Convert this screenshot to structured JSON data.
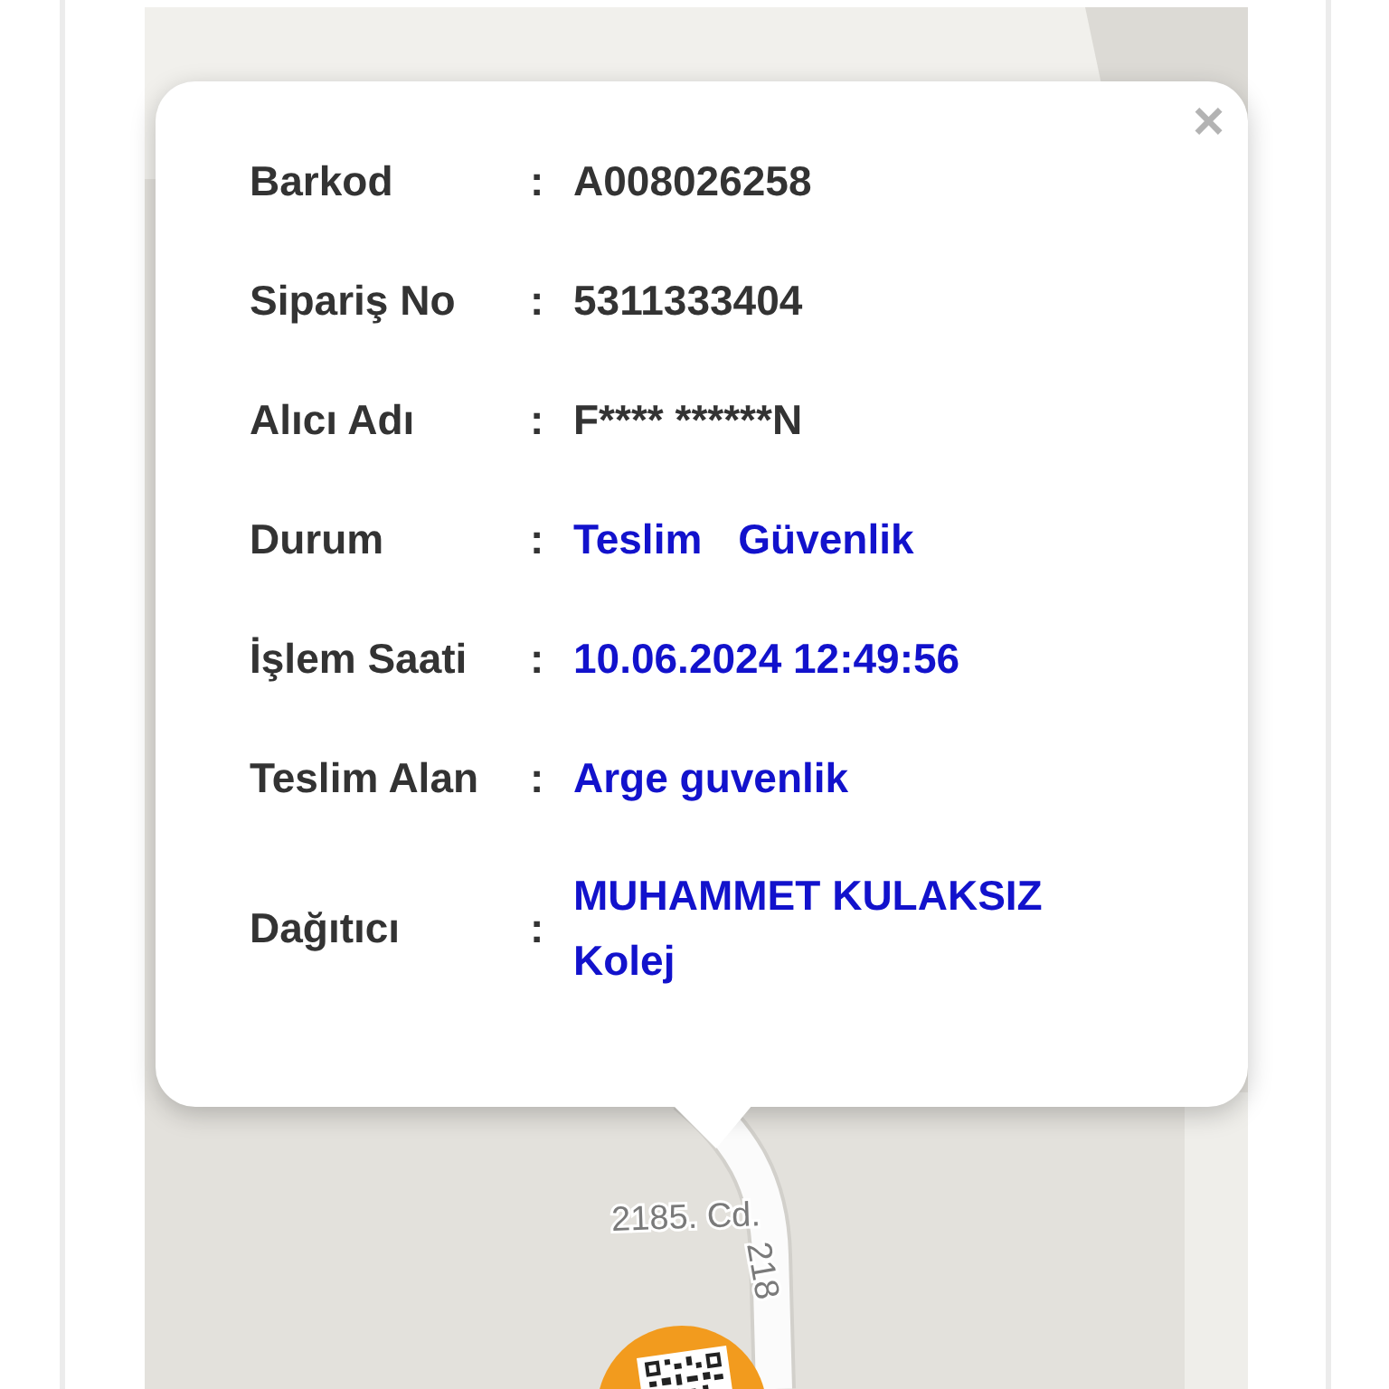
{
  "popup": {
    "close": "×",
    "rows": [
      {
        "label": "Barkod",
        "separator": ":",
        "values": [
          "A008026258"
        ],
        "highlighted": false,
        "stacked": false
      },
      {
        "label": "Sipariş No",
        "separator": ":",
        "values": [
          "5311333404"
        ],
        "highlighted": false,
        "stacked": false
      },
      {
        "label": "Alıcı Adı",
        "separator": ":",
        "values": [
          "F**** ******N"
        ],
        "highlighted": false,
        "stacked": false
      },
      {
        "label": "Durum",
        "separator": ":",
        "values": [
          "Teslim",
          "Güvenlik"
        ],
        "highlighted": true,
        "stacked": false
      },
      {
        "label": "İşlem Saati",
        "separator": ":",
        "values": [
          "10.06.2024 12:49:56"
        ],
        "highlighted": true,
        "stacked": false
      },
      {
        "label": "Teslim Alan",
        "separator": ":",
        "values": [
          "Arge guvenlik"
        ],
        "highlighted": true,
        "stacked": false
      },
      {
        "label": "Dağıtıcı",
        "separator": ":",
        "values": [
          "MUHAMMET KULAKSIZ",
          "Kolej"
        ],
        "highlighted": true,
        "stacked": true
      }
    ]
  },
  "map": {
    "street_labels": [
      {
        "text": "2185. Cd.",
        "kind": "horizontal"
      },
      {
        "text": "218",
        "kind": "vertical"
      }
    ]
  }
}
